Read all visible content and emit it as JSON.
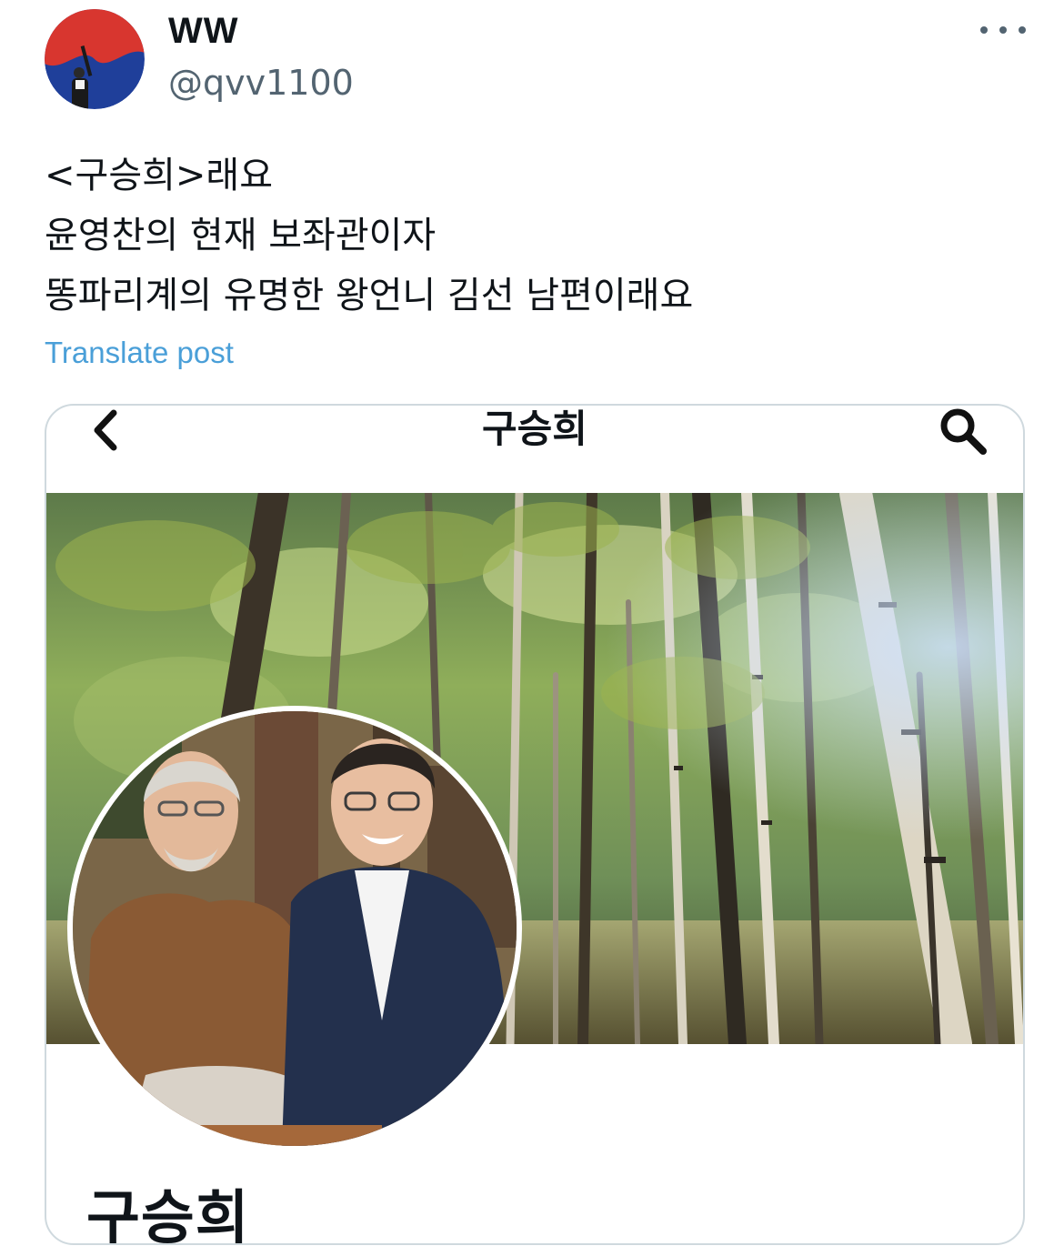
{
  "tweet": {
    "author": {
      "display_name": "WW",
      "handle": "@qvv1100",
      "avatar_icon": "avatar-photo"
    },
    "more_icon": "more-horizontal-icon",
    "text_lines": [
      "<구승희>래요",
      "윤영찬의 현재 보좌관이자",
      "똥파리계의 유명한 왕언니 김선 남편이래요"
    ],
    "translate_label": "Translate post",
    "colors": {
      "link": "#4a9fd8",
      "secondary": "#536471",
      "border": "#cfd9de"
    }
  },
  "media": {
    "header": {
      "back_icon": "chevron-left-icon",
      "title": "구승희",
      "search_icon": "search-icon"
    },
    "cover_photo": "birch-forest-photo",
    "profile_photo": "two-men-smiling-photo",
    "profile_name": "구승희"
  }
}
